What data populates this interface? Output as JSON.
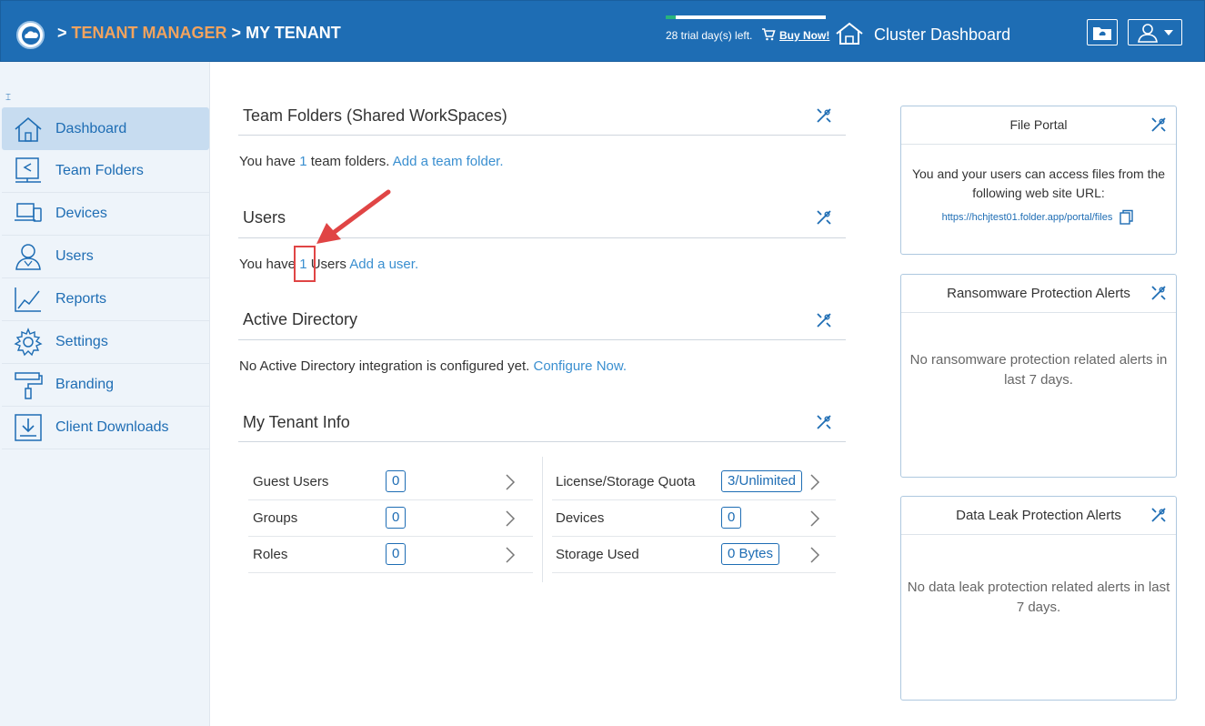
{
  "header": {
    "breadcrumb_sep1": ">",
    "tenant_manager": "TENANT MANAGER",
    "breadcrumb_sep2": ">",
    "my_tenant": "MY TENANT",
    "trial_text": "28 trial day(s) left.",
    "trial_progress": 0.06,
    "buy_now": "Buy Now!",
    "cluster_dashboard": "Cluster Dashboard",
    "accent_color": "#1e6db4",
    "highlight_color": "#f2a35e"
  },
  "sidebar": {
    "items": [
      {
        "label": "Dashboard",
        "icon": "home-icon",
        "active": true
      },
      {
        "label": "Team Folders",
        "icon": "shared-folder-icon",
        "active": false
      },
      {
        "label": "Devices",
        "icon": "devices-icon",
        "active": false
      },
      {
        "label": "Users",
        "icon": "users-icon",
        "active": false
      },
      {
        "label": "Reports",
        "icon": "chart-icon",
        "active": false
      },
      {
        "label": "Settings",
        "icon": "gear-icon",
        "active": false
      },
      {
        "label": "Branding",
        "icon": "paint-roller-icon",
        "active": false
      },
      {
        "label": "Client Downloads",
        "icon": "download-icon",
        "active": false
      }
    ]
  },
  "main": {
    "team_folders": {
      "title": "Team Folders (Shared WorkSpaces)",
      "text_prefix": "You have ",
      "count": "1",
      "text_suffix": " team folders. ",
      "link": "Add a team folder."
    },
    "users": {
      "title": "Users",
      "text_prefix": "You have ",
      "count": "1",
      "text_suffix": " Users ",
      "link": "Add a user."
    },
    "active_directory": {
      "title": "Active Directory",
      "text": "No Active Directory integration is configured yet. ",
      "link": "Configure Now."
    },
    "tenant_info": {
      "title": "My Tenant Info",
      "left": [
        {
          "label": "Guest Users",
          "value": "0"
        },
        {
          "label": "Groups",
          "value": "0"
        },
        {
          "label": "Roles",
          "value": "0"
        }
      ],
      "right": [
        {
          "label": "License/Storage Quota",
          "value": "3/Unlimited"
        },
        {
          "label": "Devices",
          "value": "0"
        },
        {
          "label": "Storage Used",
          "value": "0 Bytes"
        }
      ]
    }
  },
  "panels": {
    "file_portal": {
      "title": "File Portal",
      "text": "You and your users can access files from the following web site URL:",
      "url": "https://hchjtest01.folder.app/portal/files"
    },
    "ransomware": {
      "title": "Ransomware Protection Alerts",
      "text": "No ransomware protection related alerts in last 7 days."
    },
    "data_leak": {
      "title": "Data Leak Protection Alerts",
      "text": "No data leak protection related alerts in last 7 days."
    }
  },
  "annotation": {
    "color": "#e04545"
  }
}
